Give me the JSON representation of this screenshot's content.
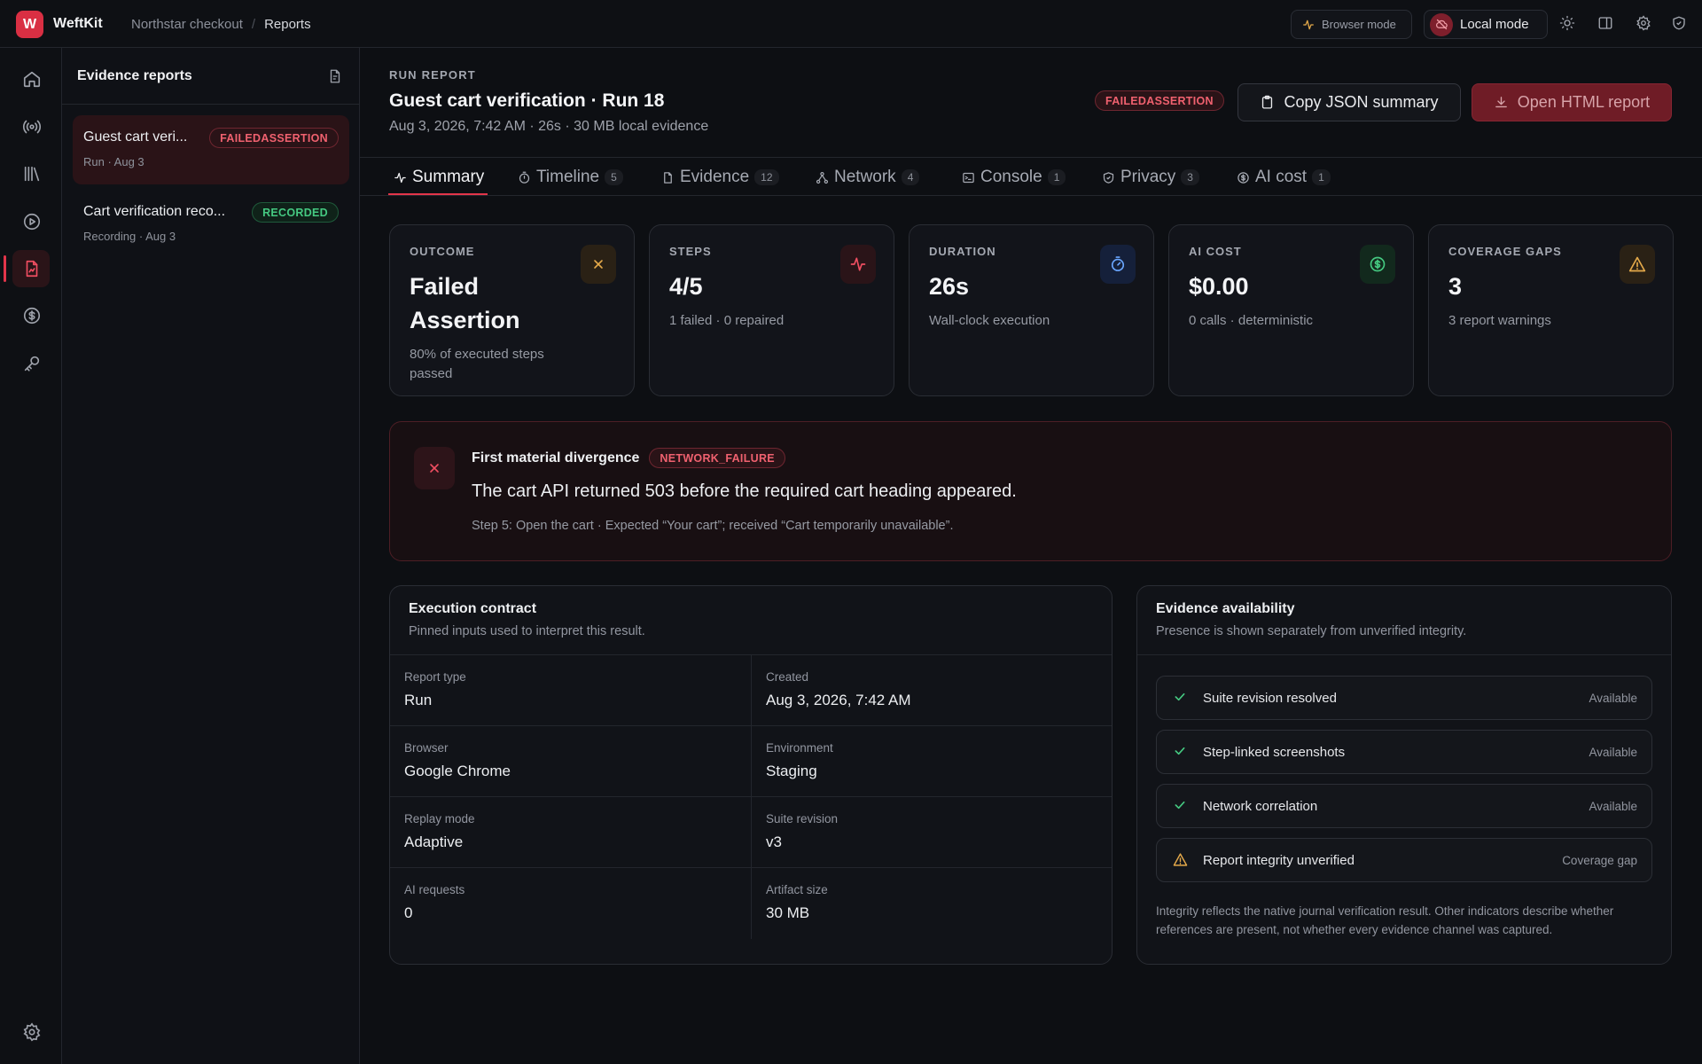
{
  "app": {
    "logo_letter": "W",
    "name": "WeftKit"
  },
  "breadcrumb": {
    "project": "Northstar checkout",
    "sep": "/",
    "page": "Reports"
  },
  "top_actions": {
    "browser_mode": "Browser mode",
    "local_mode": "Local mode"
  },
  "colors": {
    "accent": "#e2354a",
    "danger": "#f0616f",
    "success": "#45c981",
    "warning": "#e4a94a",
    "info": "#6aa6ff"
  },
  "rail": {
    "icons": [
      "home-icon",
      "broadcast-icon",
      "library-icon",
      "play-icon",
      "report-icon",
      "dollar-icon",
      "key-icon",
      "gear-icon"
    ],
    "active": "report-icon"
  },
  "list": {
    "title": "Evidence reports",
    "items": [
      {
        "name": "Guest cart veri...",
        "meta": "Run · Aug 3",
        "badge": "FAILEDASSERTION"
      },
      {
        "name": "Cart verification reco...",
        "meta": "Recording · Aug 3",
        "badge": "RECORDED"
      }
    ]
  },
  "report": {
    "eyebrow": "RUN REPORT",
    "title": "Guest cart verification · Run 18",
    "subtitle": "Aug 3, 2026, 7:42 AM · 26s · 30 MB local evidence",
    "status_badge": "FAILEDASSERTION",
    "copy_button": "Copy JSON summary",
    "open_button": "Open HTML report"
  },
  "tabs": [
    {
      "label": "Summary",
      "count": "",
      "icon": "pulse-icon"
    },
    {
      "label": "Timeline",
      "count": "5",
      "icon": "timer-icon"
    },
    {
      "label": "Evidence",
      "count": "12",
      "icon": "document-icon"
    },
    {
      "label": "Network",
      "count": "4",
      "icon": "network-icon"
    },
    {
      "label": "Console",
      "count": "1",
      "icon": "console-icon"
    },
    {
      "label": "Privacy",
      "count": "3",
      "icon": "shield-icon"
    },
    {
      "label": "AI cost",
      "count": "1",
      "icon": "dollar-icon"
    }
  ],
  "metrics": [
    {
      "label": "OUTCOME",
      "value": "Failed Assertion",
      "sub": "80% of executed steps passed",
      "icon": "x-icon"
    },
    {
      "label": "STEPS",
      "value": "4/5",
      "sub": "1 failed · 0 repaired",
      "icon": "pulse-icon"
    },
    {
      "label": "DURATION",
      "value": "26s",
      "sub": "Wall-clock execution",
      "icon": "stopwatch-icon"
    },
    {
      "label": "AI COST",
      "value": "$0.00",
      "sub": "0 calls · deterministic",
      "icon": "dollar-icon"
    },
    {
      "label": "COVERAGE GAPS",
      "value": "3",
      "sub": "3 report warnings",
      "icon": "warning-icon"
    }
  ],
  "divergence": {
    "title": "First material divergence",
    "badge": "NETWORK_FAILURE",
    "message": "The cart API returned 503 before the required cart heading appeared.",
    "detail": "Step 5: Open the cart · Expected “Your cart”; received “Cart temporarily unavailable”."
  },
  "contract": {
    "title": "Execution contract",
    "subtitle": "Pinned inputs used to interpret this result.",
    "rows": [
      [
        {
          "label": "Report type",
          "value": "Run"
        },
        {
          "label": "Created",
          "value": "Aug 3, 2026, 7:42 AM"
        }
      ],
      [
        {
          "label": "Browser",
          "value": "Google Chrome"
        },
        {
          "label": "Environment",
          "value": "Staging"
        }
      ],
      [
        {
          "label": "Replay mode",
          "value": "Adaptive"
        },
        {
          "label": "Suite revision",
          "value": "v3"
        }
      ],
      [
        {
          "label": "AI requests",
          "value": "0"
        },
        {
          "label": "Artifact size",
          "value": "30 MB"
        }
      ]
    ]
  },
  "availability": {
    "title": "Evidence availability",
    "subtitle": "Presence is shown separately from unverified integrity.",
    "items": [
      {
        "name": "Suite revision resolved",
        "status": "Available",
        "icon": "check-icon"
      },
      {
        "name": "Step-linked screenshots",
        "status": "Available",
        "icon": "check-icon"
      },
      {
        "name": "Network correlation",
        "status": "Available",
        "icon": "check-icon"
      },
      {
        "name": "Report integrity unverified",
        "status": "Coverage gap",
        "icon": "warning-icon"
      }
    ],
    "note": "Integrity reflects the native journal verification result. Other indicators describe whether references are present, not whether every evidence channel was captured."
  }
}
